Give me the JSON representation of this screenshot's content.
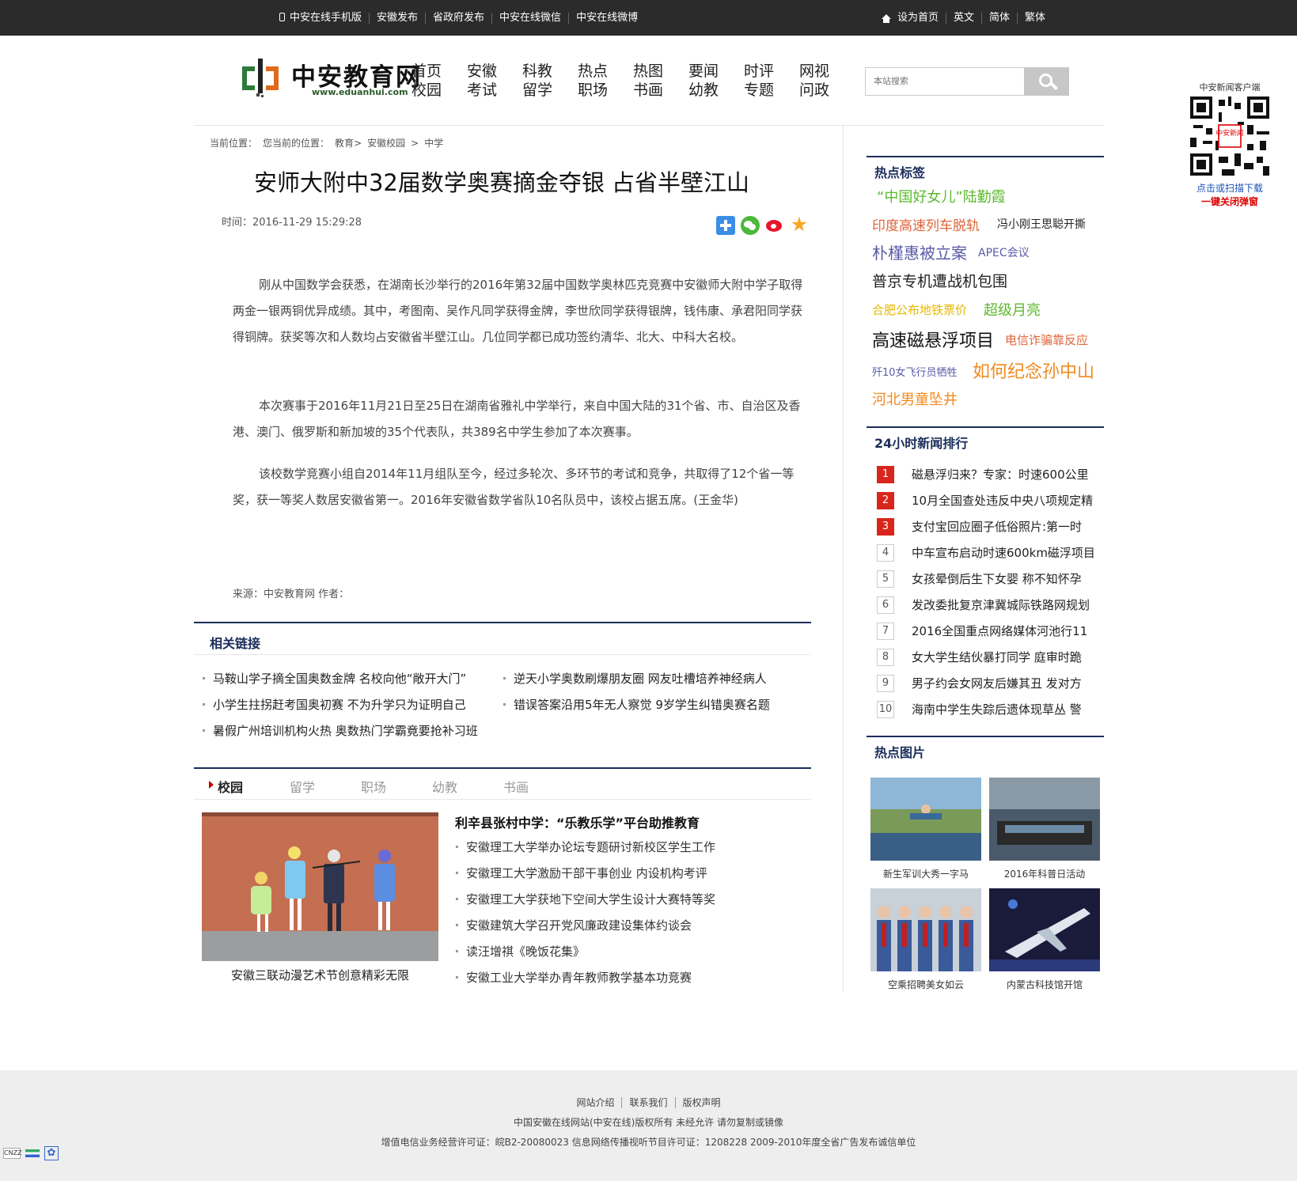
{
  "topbar": {
    "left": [
      "中安在线手机版",
      "安徽发布",
      "省政府发布",
      "中安在线微信",
      "中安在线微博"
    ],
    "right": [
      "设为首页",
      "英文",
      "简体",
      "繁体"
    ]
  },
  "logo": {
    "name": "中安教育网",
    "url": "www.eduanhui.com"
  },
  "nav": [
    [
      "首页",
      "校园"
    ],
    [
      "安徽",
      "考试"
    ],
    [
      "科教",
      "留学"
    ],
    [
      "热点",
      "职场"
    ],
    [
      "热图",
      "书画"
    ],
    [
      "要闻",
      "幼教"
    ],
    [
      "时评",
      "专题"
    ],
    [
      "网视",
      "问政"
    ]
  ],
  "search": {
    "placeholder": "本站搜索"
  },
  "qr": {
    "title": "中安新闻客户端",
    "center": "中安新闻",
    "line1": "点击或扫描下载",
    "line2": "一键关闭弹窗"
  },
  "breadcrumb": [
    "当前位置：",
    "您当前的位置",
    "：",
    "教育",
    ">",
    "安徽校园",
    ">",
    "中学"
  ],
  "article": {
    "title": "安师大附中32届数学奥赛摘金夺银 占省半壁江山",
    "time": "时间：2016-11-29 15:29:28",
    "paragraphs": [
      "刚从中国数学会获悉，在湖南长沙举行的2016年第32届中国数学奥林匹克竞赛中安徽师大附中学子取得两金一银两铜优异成绩。其中，考图南、吴作凡同学获得金牌，李世欣同学获得银牌，钱伟康、承君阳同学获得铜牌。获奖等次和人数均占安徽省半壁江山。几位同学都已成功签约清华、北大、中科大名校。",
      "本次赛事于2016年11月21日至25日在湖南省雅礼中学举行，来自中国大陆的31个省、市、自治区及香港、澳门、俄罗斯和新加坡的35个代表队，共389名中学生参加了本次赛事。",
      "该校数学竞赛小组自2014年11月组队至今，经过多轮次、多环节的考试和竞争，共取得了12个省一等奖，获一等奖人数居安徽省第一。2016年安徽省数学省队10名队员中，该校占据五席。(王金华)"
    ],
    "source": "来源：中安教育网  作者："
  },
  "related": {
    "title": "相关链接",
    "links": [
      "马鞍山学子摘全国奥数金牌 名校向他“敞开大门”",
      "逆天小学奥数刷爆朋友圈 网友吐槽培养神经病人",
      "小学生拄拐赶考国奥初赛 不为升学只为证明自己",
      "错误答案沿用5年无人察觉 9岁学生纠错奥赛名题",
      "暑假广州培训机构火热 奥数热门学霸竟要抢补习班"
    ]
  },
  "tabs": [
    "校园",
    "留学",
    "职场",
    "幼教",
    "书画"
  ],
  "campus": {
    "caption": "安徽三联动漫艺术节创意精彩无限",
    "headline": "利辛县张村中学：“乐教乐学”平台助推教育",
    "items": [
      "安徽理工大学举办论坛专题研讨新校区学生工作",
      "安徽理工大学激励干部干事创业 内设机构考评",
      "安徽理工大学获地下空间大学生设计大赛特等奖",
      "安徽建筑大学召开党风廉政建设集体约谈会",
      "读汪增祺《晚饭花集》",
      "安徽工业大学举办青年教师教学基本功竞赛"
    ]
  },
  "hot_tags": {
    "title": "热点标签",
    "tags": [
      {
        "text": "“中国好女儿”陆勤霞",
        "color": "#5cb82e"
      },
      {
        "text": "印度高速列车脱轨",
        "color": "#e0643a"
      },
      {
        "text": "冯小刚王思聪开撕",
        "color": "#222222"
      },
      {
        "text": "朴槿惠被立案",
        "color": "#5a5aa8"
      },
      {
        "text": "APEC会议",
        "color": "#5a5aa8"
      },
      {
        "text": "普京专机遭战机包围",
        "color": "#222222"
      },
      {
        "text": "合肥公布地铁票价",
        "color": "#e6b800"
      },
      {
        "text": "超级月亮",
        "color": "#5cb82e"
      },
      {
        "text": "高速磁悬浮项目",
        "color": "#111111"
      },
      {
        "text": "电信诈骗靠反应",
        "color": "#e0643a"
      },
      {
        "text": "歼10女飞行员牺牲",
        "color": "#5a5aa8"
      },
      {
        "text": "如何纪念孙中山",
        "color": "#f08a1e"
      },
      {
        "text": "河北男童坠井",
        "color": "#f08a1e"
      }
    ]
  },
  "ranking": {
    "title": "24小时新闻排行",
    "items": [
      {
        "no": "1",
        "text": "磁悬浮归来？专家：时速600公里"
      },
      {
        "no": "2",
        "text": "10月全国查处违反中央八项规定精"
      },
      {
        "no": "3",
        "text": "支付宝回应圈子低俗照片:第一时"
      },
      {
        "no": "4",
        "text": "中车宣布启动时速600km磁浮项目"
      },
      {
        "no": "5",
        "text": "女孩晕倒后生下女婴 称不知怀孕"
      },
      {
        "no": "6",
        "text": "发改委批复京津冀城际铁路网规划"
      },
      {
        "no": "7",
        "text": "2016全国重点网络媒体河池行11"
      },
      {
        "no": "8",
        "text": "女大学生结伙暴打同学 庭审时跪"
      },
      {
        "no": "9",
        "text": "男子约会女网友后嫌其丑 发对方"
      },
      {
        "no": "10",
        "text": "海南中学生失踪后遗体现草丛 警"
      }
    ]
  },
  "hot_pics": {
    "title": "热点图片",
    "items": [
      "新生军训大秀一字马",
      "2016年科普日活动",
      "空乘招聘美女如云",
      "内蒙古科技馆开馆"
    ]
  },
  "footer": {
    "links": [
      "网站介绍",
      "联系我们",
      "版权声明"
    ],
    "copyright": "中国安徽在线网站(中安在线)版权所有 未经允许 请勿复制或镜像",
    "license": "增值电信业务经营许可证：皖B2-20080023 信息网络传播视听节目许可证：1208228   2009-2010年度全省广告发布诚信单位",
    "badge": "CNZZ"
  }
}
